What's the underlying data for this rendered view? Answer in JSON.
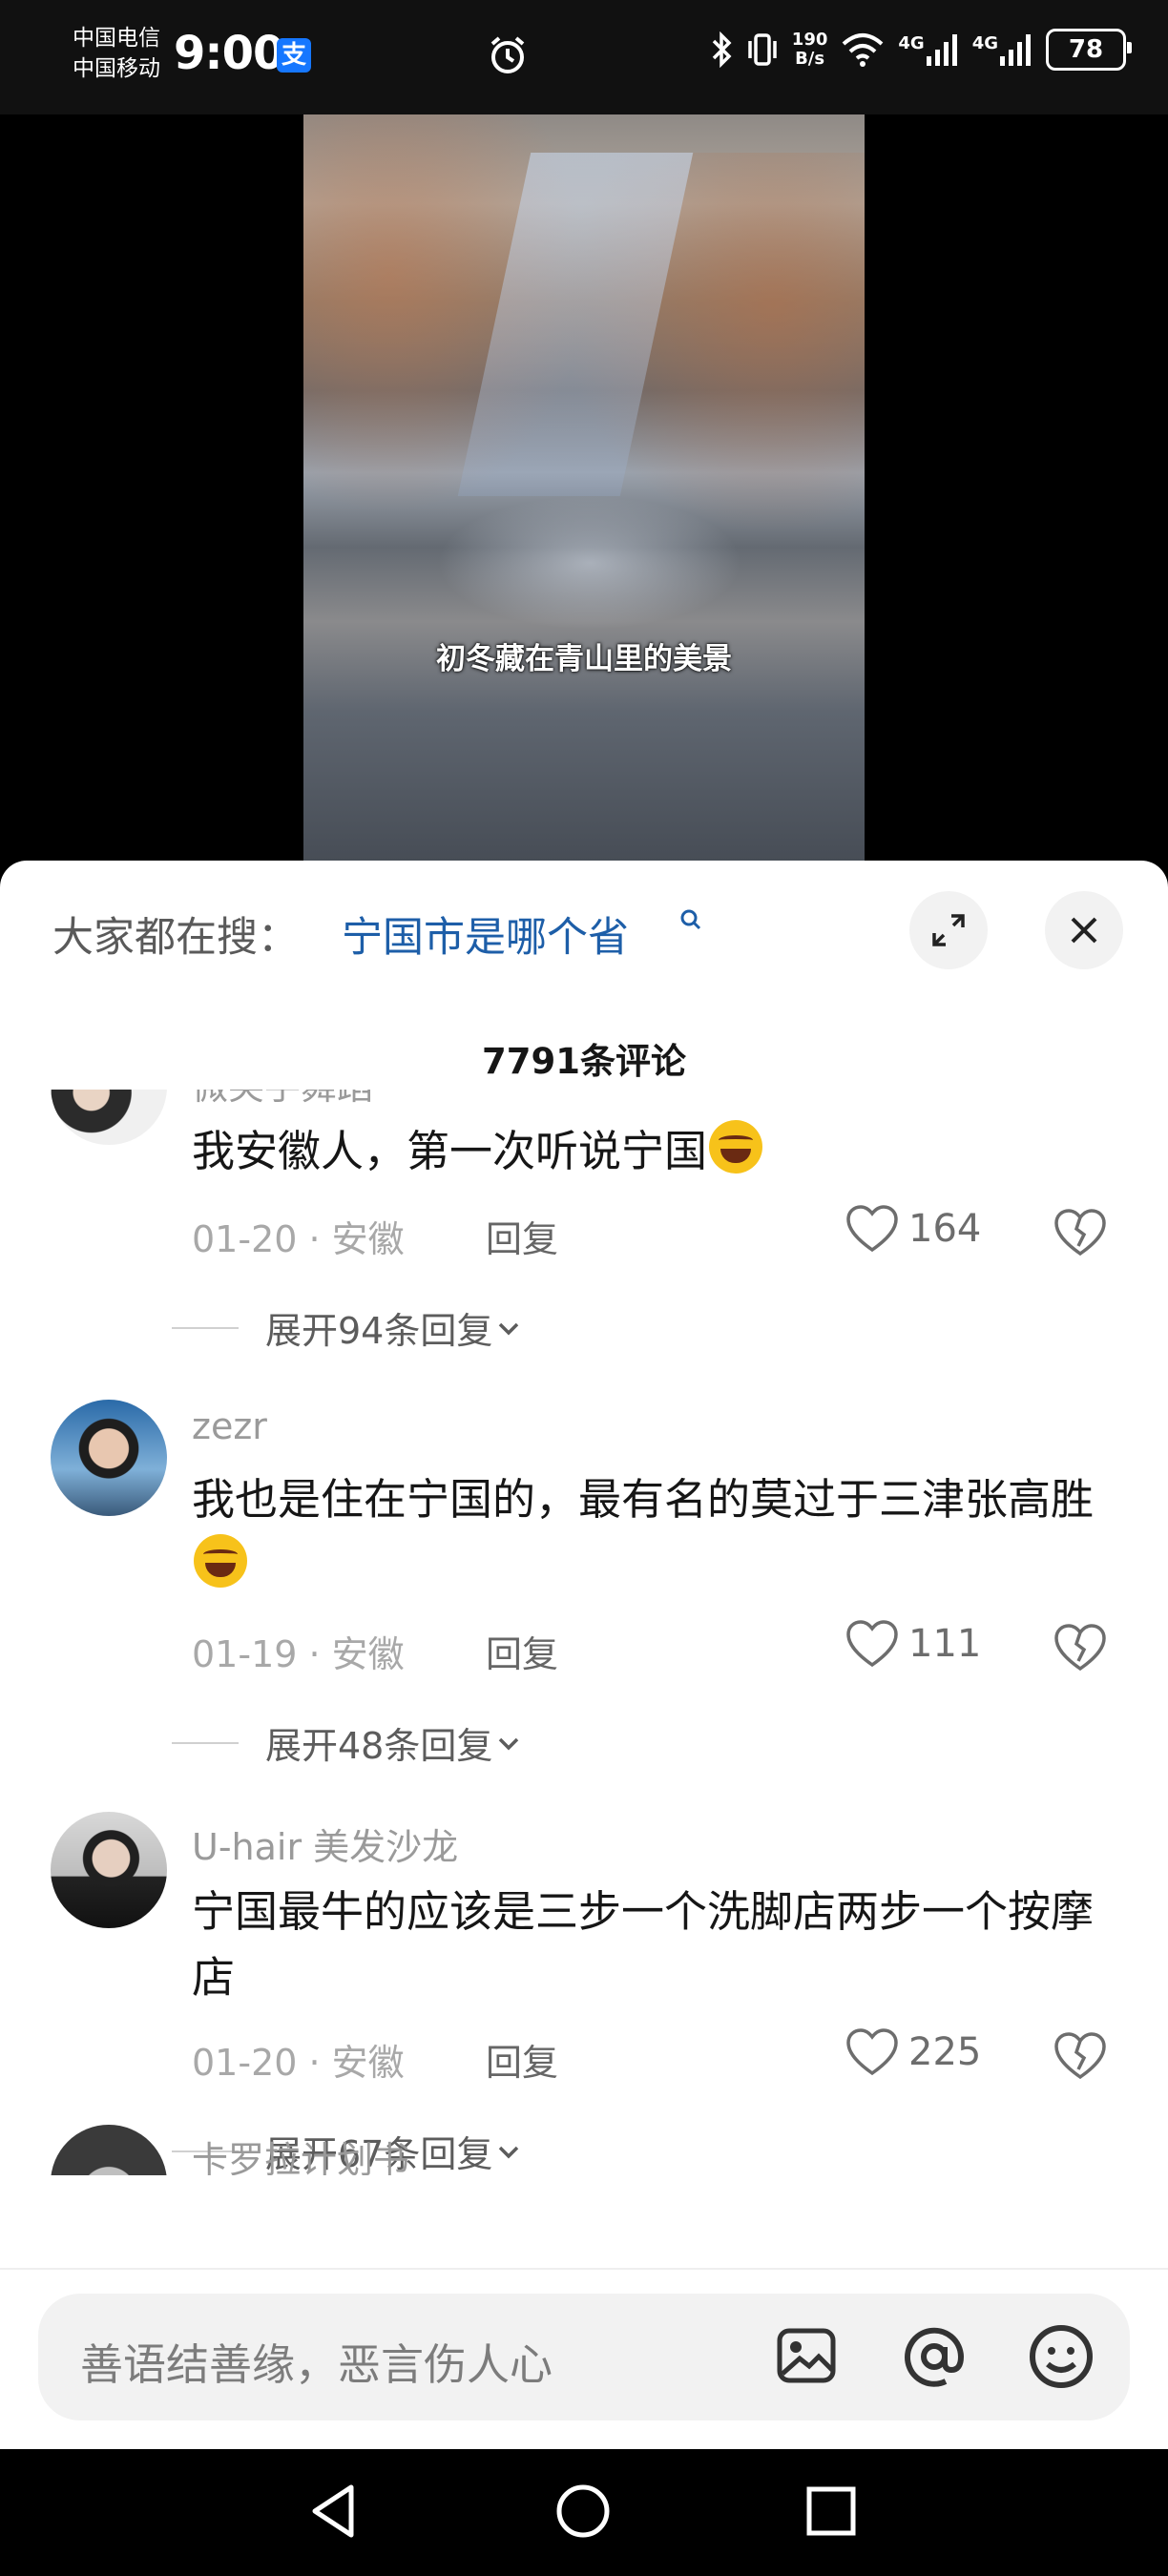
{
  "status_bar": {
    "carrier_1": "中国电信",
    "carrier_2": "中国移动",
    "time": "9:00",
    "net_speed_value": "190",
    "net_speed_unit": "B/s",
    "network_1": "4G",
    "network_2": "4G",
    "battery": "78"
  },
  "video": {
    "caption": "初冬藏在青山里的美景"
  },
  "comments_panel": {
    "search_prompt": "大家都在搜：",
    "search_term": "宁国市是哪个省",
    "count_label": "7791条评论",
    "comments": [
      {
        "username": "微笑手舞蹈",
        "text": "我安徽人，第一次听说宁国",
        "date_location": "01-20 · 安徽",
        "reply_label": "回复",
        "likes": "164",
        "expand_label": "展开94条回复"
      },
      {
        "username": "zezr",
        "text": "我也是住在宁国的，最有名的莫过于三津张高胜",
        "date_location": "01-19 · 安徽",
        "reply_label": "回复",
        "likes": "111",
        "expand_label": "展开48条回复"
      },
      {
        "username": "U-hair 美发沙龙",
        "text": "宁国最牛的应该是三步一个洗脚店两步一个按摩店",
        "date_location": "01-20 · 安徽",
        "reply_label": "回复",
        "likes": "225",
        "expand_label": "展开67条回复"
      },
      {
        "username": "卡罗拉计划书"
      }
    ]
  },
  "input_bar": {
    "placeholder": "善语结善缘，恶言伤人心"
  },
  "colors": {
    "accent_blue": "#1d5ea8",
    "sheet_bg": "#ffffff",
    "status_bg": "#111111"
  },
  "icons": [
    "alipay-icon",
    "alarm-icon",
    "bluetooth-icon",
    "vibrate-icon",
    "wifi-icon",
    "signal-icon",
    "battery-icon",
    "search-icon",
    "expand-icon",
    "close-icon",
    "heart-icon",
    "broken-heart-icon",
    "chevron-down-icon",
    "image-icon",
    "at-icon",
    "emoji-icon",
    "back-icon",
    "home-icon",
    "recents-icon"
  ]
}
